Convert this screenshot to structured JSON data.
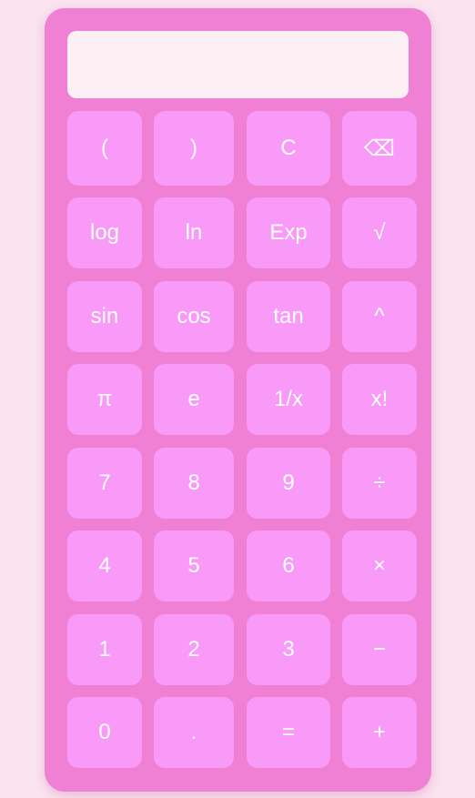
{
  "display": {
    "value": ""
  },
  "keys": {
    "open_paren": "(",
    "close_paren": ")",
    "clear": "C",
    "backspace": "⌫",
    "log": "log",
    "ln": "ln",
    "exp": "Exp",
    "sqrt": "√",
    "sin": "sin",
    "cos": "cos",
    "tan": "tan",
    "power": "^",
    "pi": "π",
    "e": "e",
    "reciprocal": "1/x",
    "factorial": "x!",
    "seven": "7",
    "eight": "8",
    "nine": "9",
    "divide": "÷",
    "four": "4",
    "five": "5",
    "six": "6",
    "multiply": "×",
    "one": "1",
    "two": "2",
    "three": "3",
    "subtract": "−",
    "zero": "0",
    "decimal": ".",
    "equals": "=",
    "add": "+"
  },
  "colors": {
    "page_background": "#fbe4f0",
    "calculator_body": "#ef80d4",
    "display_background": "#fdf0f4",
    "key_background": "#f99af8",
    "key_text": "#ffffff"
  }
}
